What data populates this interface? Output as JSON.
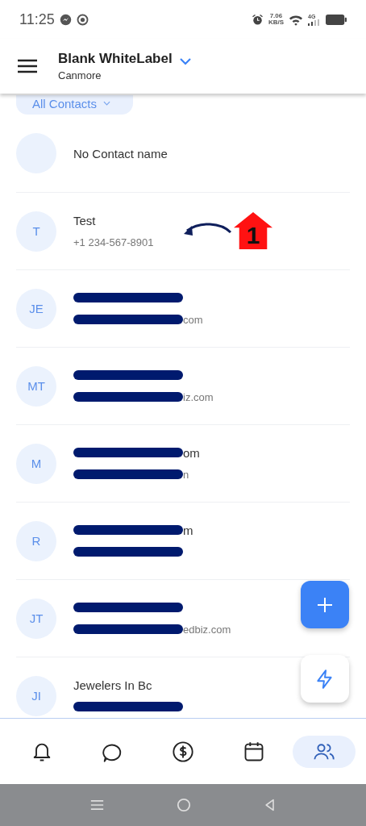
{
  "status_bar": {
    "time": "11:25",
    "speed": "7.06",
    "speed_unit": "KB/S",
    "network": "4G"
  },
  "header": {
    "title": "Blank WhiteLabel",
    "subtitle": "Canmore"
  },
  "filter": {
    "label": "All Contacts"
  },
  "contacts": [
    {
      "name": {
        "text": "No Contact name",
        "redacted": false
      }
    },
    {
      "initials": "T",
      "name": {
        "text": "Test",
        "redacted": false
      },
      "detail": {
        "text": "+1 234-567-8901",
        "redacted": false
      }
    },
    {
      "initials": "JE",
      "name": {
        "redacted": true
      },
      "detail": {
        "text": "com",
        "redacted": true
      }
    },
    {
      "initials": "MT",
      "name": {
        "redacted": true
      },
      "detail": {
        "text": "iz.com",
        "redacted": true
      }
    },
    {
      "initials": "M",
      "name": {
        "text": "om",
        "redacted": true
      },
      "detail": {
        "text": "n",
        "redacted": true
      }
    },
    {
      "initials": "R",
      "name": {
        "text": "m",
        "redacted": true
      },
      "detail": {
        "redacted": true
      }
    },
    {
      "initials": "JT",
      "name": {
        "redacted": true
      },
      "detail": {
        "text": "edbiz.com",
        "redacted": true
      }
    },
    {
      "initials": "JI",
      "name": {
        "text": "Jewelers In Bc",
        "redacted": false
      },
      "detail": {
        "redacted": true
      }
    }
  ],
  "annotation": {
    "label": "1"
  },
  "nav": [
    {
      "kind": "bell",
      "selected": false
    },
    {
      "kind": "chat",
      "selected": false
    },
    {
      "kind": "dollar",
      "selected": false
    },
    {
      "kind": "calendar",
      "selected": false
    },
    {
      "kind": "people",
      "selected": true
    }
  ]
}
